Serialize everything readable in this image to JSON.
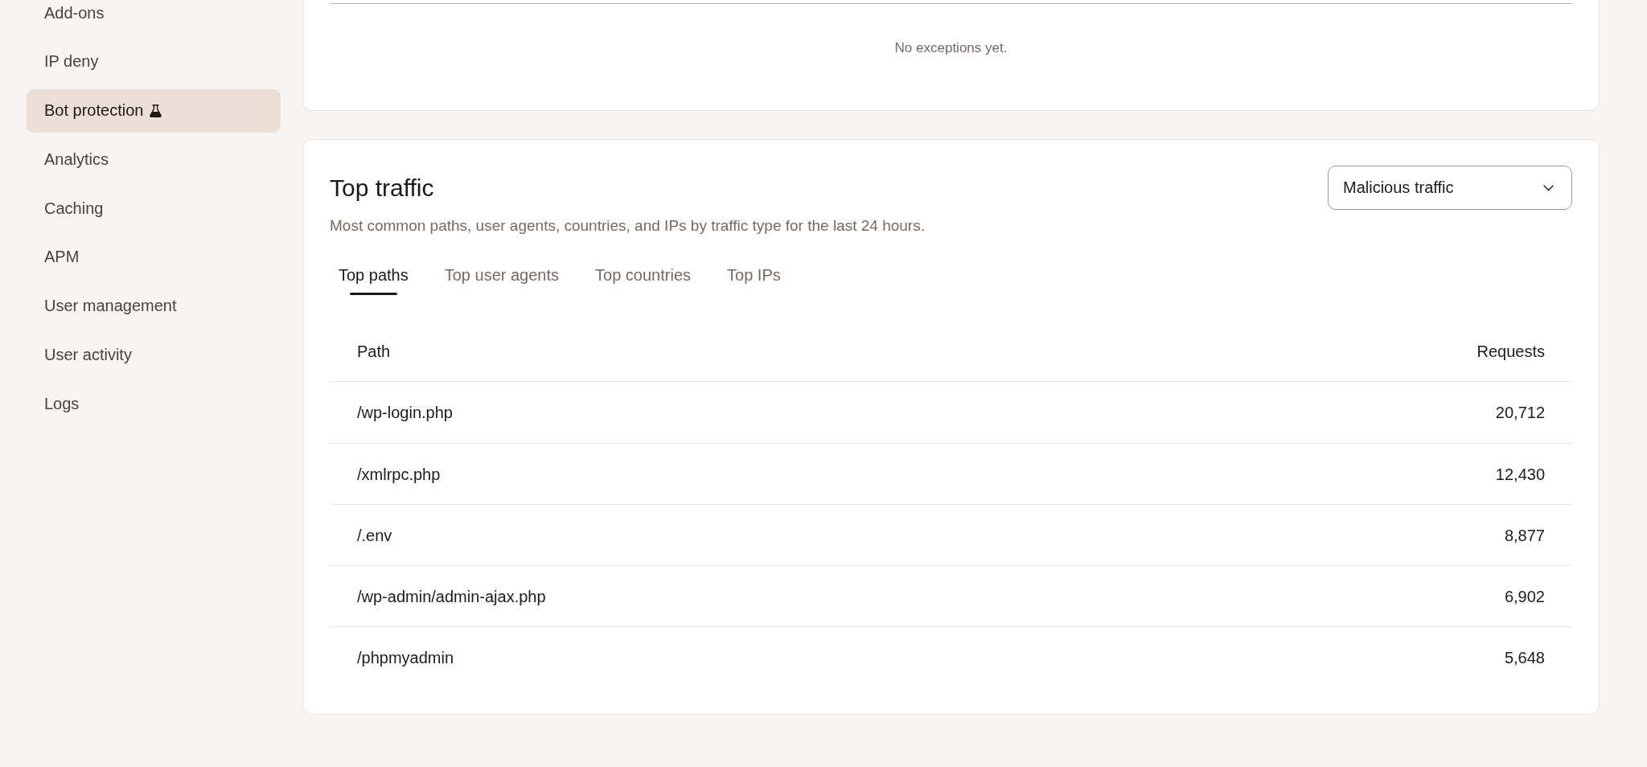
{
  "sidebar": {
    "items": [
      {
        "label": "Add-ons",
        "selected": false,
        "experimental": false
      },
      {
        "label": "IP deny",
        "selected": false,
        "experimental": false
      },
      {
        "label": "Bot protection",
        "selected": true,
        "experimental": true
      },
      {
        "label": "Analytics",
        "selected": false,
        "experimental": false
      },
      {
        "label": "Caching",
        "selected": false,
        "experimental": false
      },
      {
        "label": "APM",
        "selected": false,
        "experimental": false
      },
      {
        "label": "User management",
        "selected": false,
        "experimental": false
      },
      {
        "label": "User activity",
        "selected": false,
        "experimental": false
      },
      {
        "label": "Logs",
        "selected": false,
        "experimental": false
      }
    ]
  },
  "exceptions": {
    "empty_message": "No exceptions yet."
  },
  "top_traffic": {
    "title": "Top traffic",
    "description": "Most common paths, user agents, countries, and IPs by traffic type for the last 24 hours.",
    "traffic_type": {
      "value": "Malicious traffic"
    },
    "tabs": [
      {
        "label": "Top paths",
        "selected": true
      },
      {
        "label": "Top user agents",
        "selected": false
      },
      {
        "label": "Top countries",
        "selected": false
      },
      {
        "label": "Top IPs",
        "selected": false
      }
    ],
    "table": {
      "columns": [
        "Path",
        "Requests"
      ],
      "rows": [
        [
          "/wp-login.php",
          "20,712"
        ],
        [
          "/xmlrpc.php",
          "12,430"
        ],
        [
          "/.env",
          "8,877"
        ],
        [
          "/wp-admin/admin-ajax.php",
          "6,902"
        ],
        [
          "/phpmyadmin",
          "5,648"
        ]
      ]
    }
  }
}
